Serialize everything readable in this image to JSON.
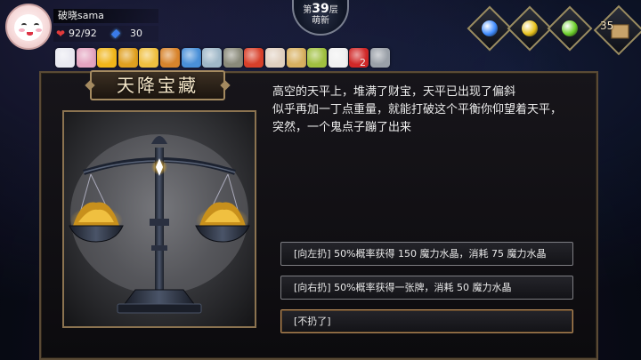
{
  "player": {
    "name": "破晓sama",
    "hp": "92/92",
    "mana": "30"
  },
  "floor": {
    "prefix": "第",
    "number": "39",
    "suffix": "层",
    "stage": "萌新"
  },
  "potions": [
    {
      "icon": "blue-potion-icon",
      "color": "#3f8cff"
    },
    {
      "icon": "yellow-potion-icon",
      "color": "#e8c21c"
    },
    {
      "icon": "green-potion-icon",
      "color": "#6ccf2a"
    }
  ],
  "chest": {
    "icon": "treasure-chest-icon",
    "count": "35"
  },
  "items": [
    {
      "icon": "white-cat-icon",
      "color": "#e8e8f0"
    },
    {
      "icon": "pink-creature-icon",
      "color": "#e4a4c0"
    },
    {
      "icon": "crown-icon",
      "color": "#f0b51a"
    },
    {
      "icon": "gold-pouch-icon",
      "color": "#e0a020"
    },
    {
      "icon": "golden-fruit-icon",
      "color": "#f0c040"
    },
    {
      "icon": "burger-icon",
      "color": "#d8842c"
    },
    {
      "icon": "cake-icon",
      "color": "#4a90d8"
    },
    {
      "icon": "feather-icon",
      "color": "#a0b8c8"
    },
    {
      "icon": "crossed-swords-icon",
      "color": "#8a8a7a"
    },
    {
      "icon": "red-potion-icon",
      "color": "#d8402a"
    },
    {
      "icon": "quill-icon",
      "color": "#e0d0c0"
    },
    {
      "icon": "vip-card-icon",
      "color": "#d8b060"
    },
    {
      "icon": "staff-icon",
      "color": "#a0c040"
    },
    {
      "icon": "dice-icon",
      "color": "#f0f0f0"
    },
    {
      "icon": "red-ring-icon",
      "color": "#d02828"
    },
    {
      "icon": "hammer-icon",
      "color": "#9aa0a8"
    }
  ],
  "item_count": "2",
  "event": {
    "title": "天降宝藏",
    "image": "balance-scale-with-gold-icon",
    "description": [
      "高空的天平上，堆满了财宝，天平已出现了偏斜",
      "似乎再加一丁点重量，就能打破这个平衡你仰望着天平，",
      "突然，一个鬼点子蹦了出来"
    ],
    "choices": [
      "[向左扔] 50%概率获得 150 魔力水晶，消耗 75 魔力水晶",
      "[向右扔] 50%概率获得一张牌，消耗 50 魔力水晶",
      "[不扔了]"
    ]
  }
}
